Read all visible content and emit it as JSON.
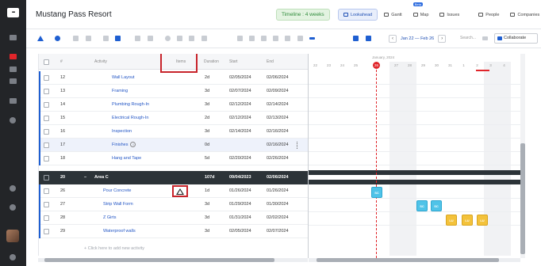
{
  "app": {
    "logo_text": "▪▪▪",
    "expand_icon": "chevron-right-icon"
  },
  "header": {
    "title": "Mustang Pass Resort",
    "timeline": "Timeline : 4 weeks",
    "tabs": [
      {
        "label": "Lookahead",
        "active": true,
        "icon": "lookahead-icon"
      },
      {
        "label": "Gantt",
        "active": false,
        "icon": "gantt-icon"
      },
      {
        "label": "Map",
        "active": false,
        "icon": "map-icon",
        "badge": "Beta"
      },
      {
        "label": "Issues",
        "active": false,
        "icon": "issues-icon"
      },
      {
        "label": "People",
        "active": false,
        "icon": "people-icon"
      },
      {
        "label": "Companies",
        "active": false,
        "icon": "companies-icon"
      }
    ]
  },
  "toolbar": {
    "date_range": "Jan 22 — Feb 26",
    "prev": "‹",
    "next": "›",
    "search_placeholder": "Search...",
    "collaborate": "Collaborate"
  },
  "table": {
    "headers": {
      "num": "#",
      "activity": "Activity",
      "items": "Items",
      "duration": "Duration",
      "start": "Start",
      "end": "End"
    },
    "rows": [
      {
        "num": "12",
        "activity": "Wall Layout",
        "duration": "2d",
        "start": "02/05/2024",
        "end": "02/06/2024"
      },
      {
        "num": "13",
        "activity": "Framing",
        "duration": "3d",
        "start": "02/07/2024",
        "end": "02/09/2024"
      },
      {
        "num": "14",
        "activity": "Plumbing Rough-In",
        "duration": "3d",
        "start": "02/12/2024",
        "end": "02/14/2024"
      },
      {
        "num": "15",
        "activity": "Electrical Rough-In",
        "duration": "2d",
        "start": "02/12/2024",
        "end": "02/13/2024"
      },
      {
        "num": "16",
        "activity": "Inspection",
        "duration": "3d",
        "start": "02/14/2024",
        "end": "02/16/2024"
      },
      {
        "num": "17",
        "activity": "Finishes",
        "duration": "0d",
        "start": "",
        "end": "02/16/2024"
      },
      {
        "num": "18",
        "activity": "Hang and Tape",
        "duration": "5d",
        "start": "02/20/2024",
        "end": "02/26/2024"
      },
      {
        "num": "20",
        "activity": "Area C",
        "duration": "107d",
        "start": "09/04/2023",
        "end": "02/06/2024"
      },
      {
        "num": "26",
        "activity": "Pour Concrete",
        "duration": "1d",
        "start": "01/26/2024",
        "end": "01/26/2024"
      },
      {
        "num": "27",
        "activity": "Strip Wall Form",
        "duration": "3d",
        "start": "01/29/2024",
        "end": "01/30/2024"
      },
      {
        "num": "28",
        "activity": "Z Girts",
        "duration": "3d",
        "start": "01/31/2024",
        "end": "02/02/2024"
      },
      {
        "num": "29",
        "activity": "Waterproof walls",
        "duration": "3d",
        "start": "02/05/2024",
        "end": "02/07/2024"
      }
    ],
    "add_row": "+ Click here to add new activity"
  },
  "gantt": {
    "month_label": "January, 2024",
    "days": [
      "22",
      "23",
      "24",
      "25",
      "26",
      "27",
      "28",
      "29",
      "30",
      "31",
      "1",
      "2",
      "3",
      "4"
    ],
    "today": "26",
    "cells": [
      {
        "label": "SC",
        "color": "#4fc3e8"
      },
      {
        "label": "SC",
        "color": "#4fc3e8"
      },
      {
        "label": "SC",
        "color": "#4fc3e8"
      },
      {
        "label": "LU",
        "color": "#f3c23b"
      },
      {
        "label": "LU",
        "color": "#f3c23b"
      },
      {
        "label": "LU",
        "color": "#f3c23b"
      }
    ]
  }
}
